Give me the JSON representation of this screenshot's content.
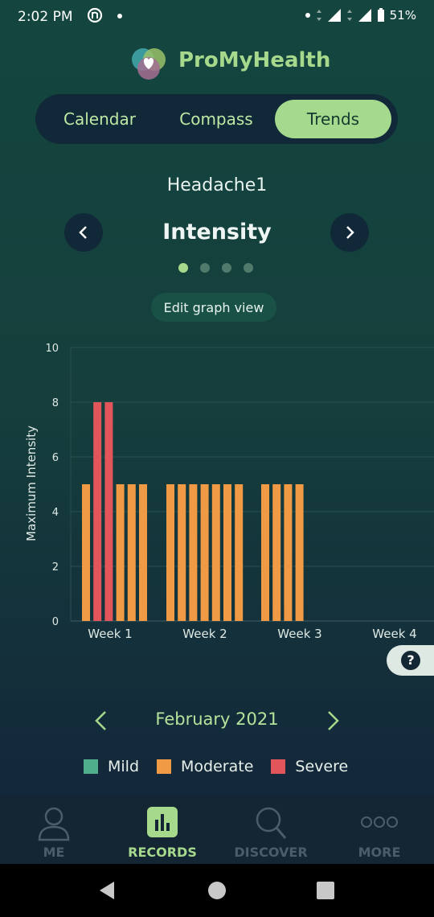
{
  "status_bar": {
    "time": "2:02 PM",
    "battery": "51%"
  },
  "app": {
    "title": "ProMyHealth"
  },
  "tabs": [
    {
      "label": "Calendar",
      "active": false
    },
    {
      "label": "Compass",
      "active": false
    },
    {
      "label": "Trends",
      "active": true
    }
  ],
  "record": {
    "name": "Headache1",
    "metric": "Intensity"
  },
  "pager": {
    "count": 4,
    "active_index": 0
  },
  "edit_button": {
    "label": "Edit graph view"
  },
  "chart_data": {
    "type": "bar",
    "ylabel": "Maximum Intensity",
    "ylim": [
      0,
      10
    ],
    "yticks": [
      "0",
      "2",
      "4",
      "6",
      "8",
      "10"
    ],
    "categories": [
      "Week 1",
      "Week 2",
      "Week 3",
      "Week 4"
    ],
    "bars": [
      {
        "week": "Week 1",
        "value": 5,
        "severity": "Moderate"
      },
      {
        "week": "Week 1",
        "value": 8,
        "severity": "Severe"
      },
      {
        "week": "Week 1",
        "value": 8,
        "severity": "Severe"
      },
      {
        "week": "Week 1",
        "value": 5,
        "severity": "Moderate"
      },
      {
        "week": "Week 1",
        "value": 5,
        "severity": "Moderate"
      },
      {
        "week": "Week 1",
        "value": 5,
        "severity": "Moderate"
      },
      {
        "week": "Week 2",
        "value": 5,
        "severity": "Moderate"
      },
      {
        "week": "Week 2",
        "value": 5,
        "severity": "Moderate"
      },
      {
        "week": "Week 2",
        "value": 5,
        "severity": "Moderate"
      },
      {
        "week": "Week 2",
        "value": 5,
        "severity": "Moderate"
      },
      {
        "week": "Week 2",
        "value": 5,
        "severity": "Moderate"
      },
      {
        "week": "Week 2",
        "value": 5,
        "severity": "Moderate"
      },
      {
        "week": "Week 2",
        "value": 5,
        "severity": "Moderate"
      },
      {
        "week": "Week 3",
        "value": 5,
        "severity": "Moderate"
      },
      {
        "week": "Week 3",
        "value": 5,
        "severity": "Moderate"
      },
      {
        "week": "Week 3",
        "value": 5,
        "severity": "Moderate"
      },
      {
        "week": "Week 3",
        "value": 5,
        "severity": "Moderate"
      }
    ],
    "colors": {
      "Mild": "#4fae8c",
      "Moderate": "#f09a45",
      "Severe": "#e2555a"
    }
  },
  "month": {
    "label": "February 2021"
  },
  "legend": [
    {
      "label": "Mild",
      "color": "#4fae8c"
    },
    {
      "label": "Moderate",
      "color": "#f09a45"
    },
    {
      "label": "Severe",
      "color": "#e2555a"
    }
  ],
  "bottom_nav": [
    {
      "label": "ME",
      "icon": "person-icon",
      "active": false
    },
    {
      "label": "RECORDS",
      "icon": "bar-chart-icon",
      "active": true
    },
    {
      "label": "DISCOVER",
      "icon": "magnifier-icon",
      "active": false
    },
    {
      "label": "MORE",
      "icon": "more-dots-icon",
      "active": false
    }
  ],
  "theme": {
    "accent": "#a7d98c",
    "inactive_nav": "#4a5d6a"
  }
}
